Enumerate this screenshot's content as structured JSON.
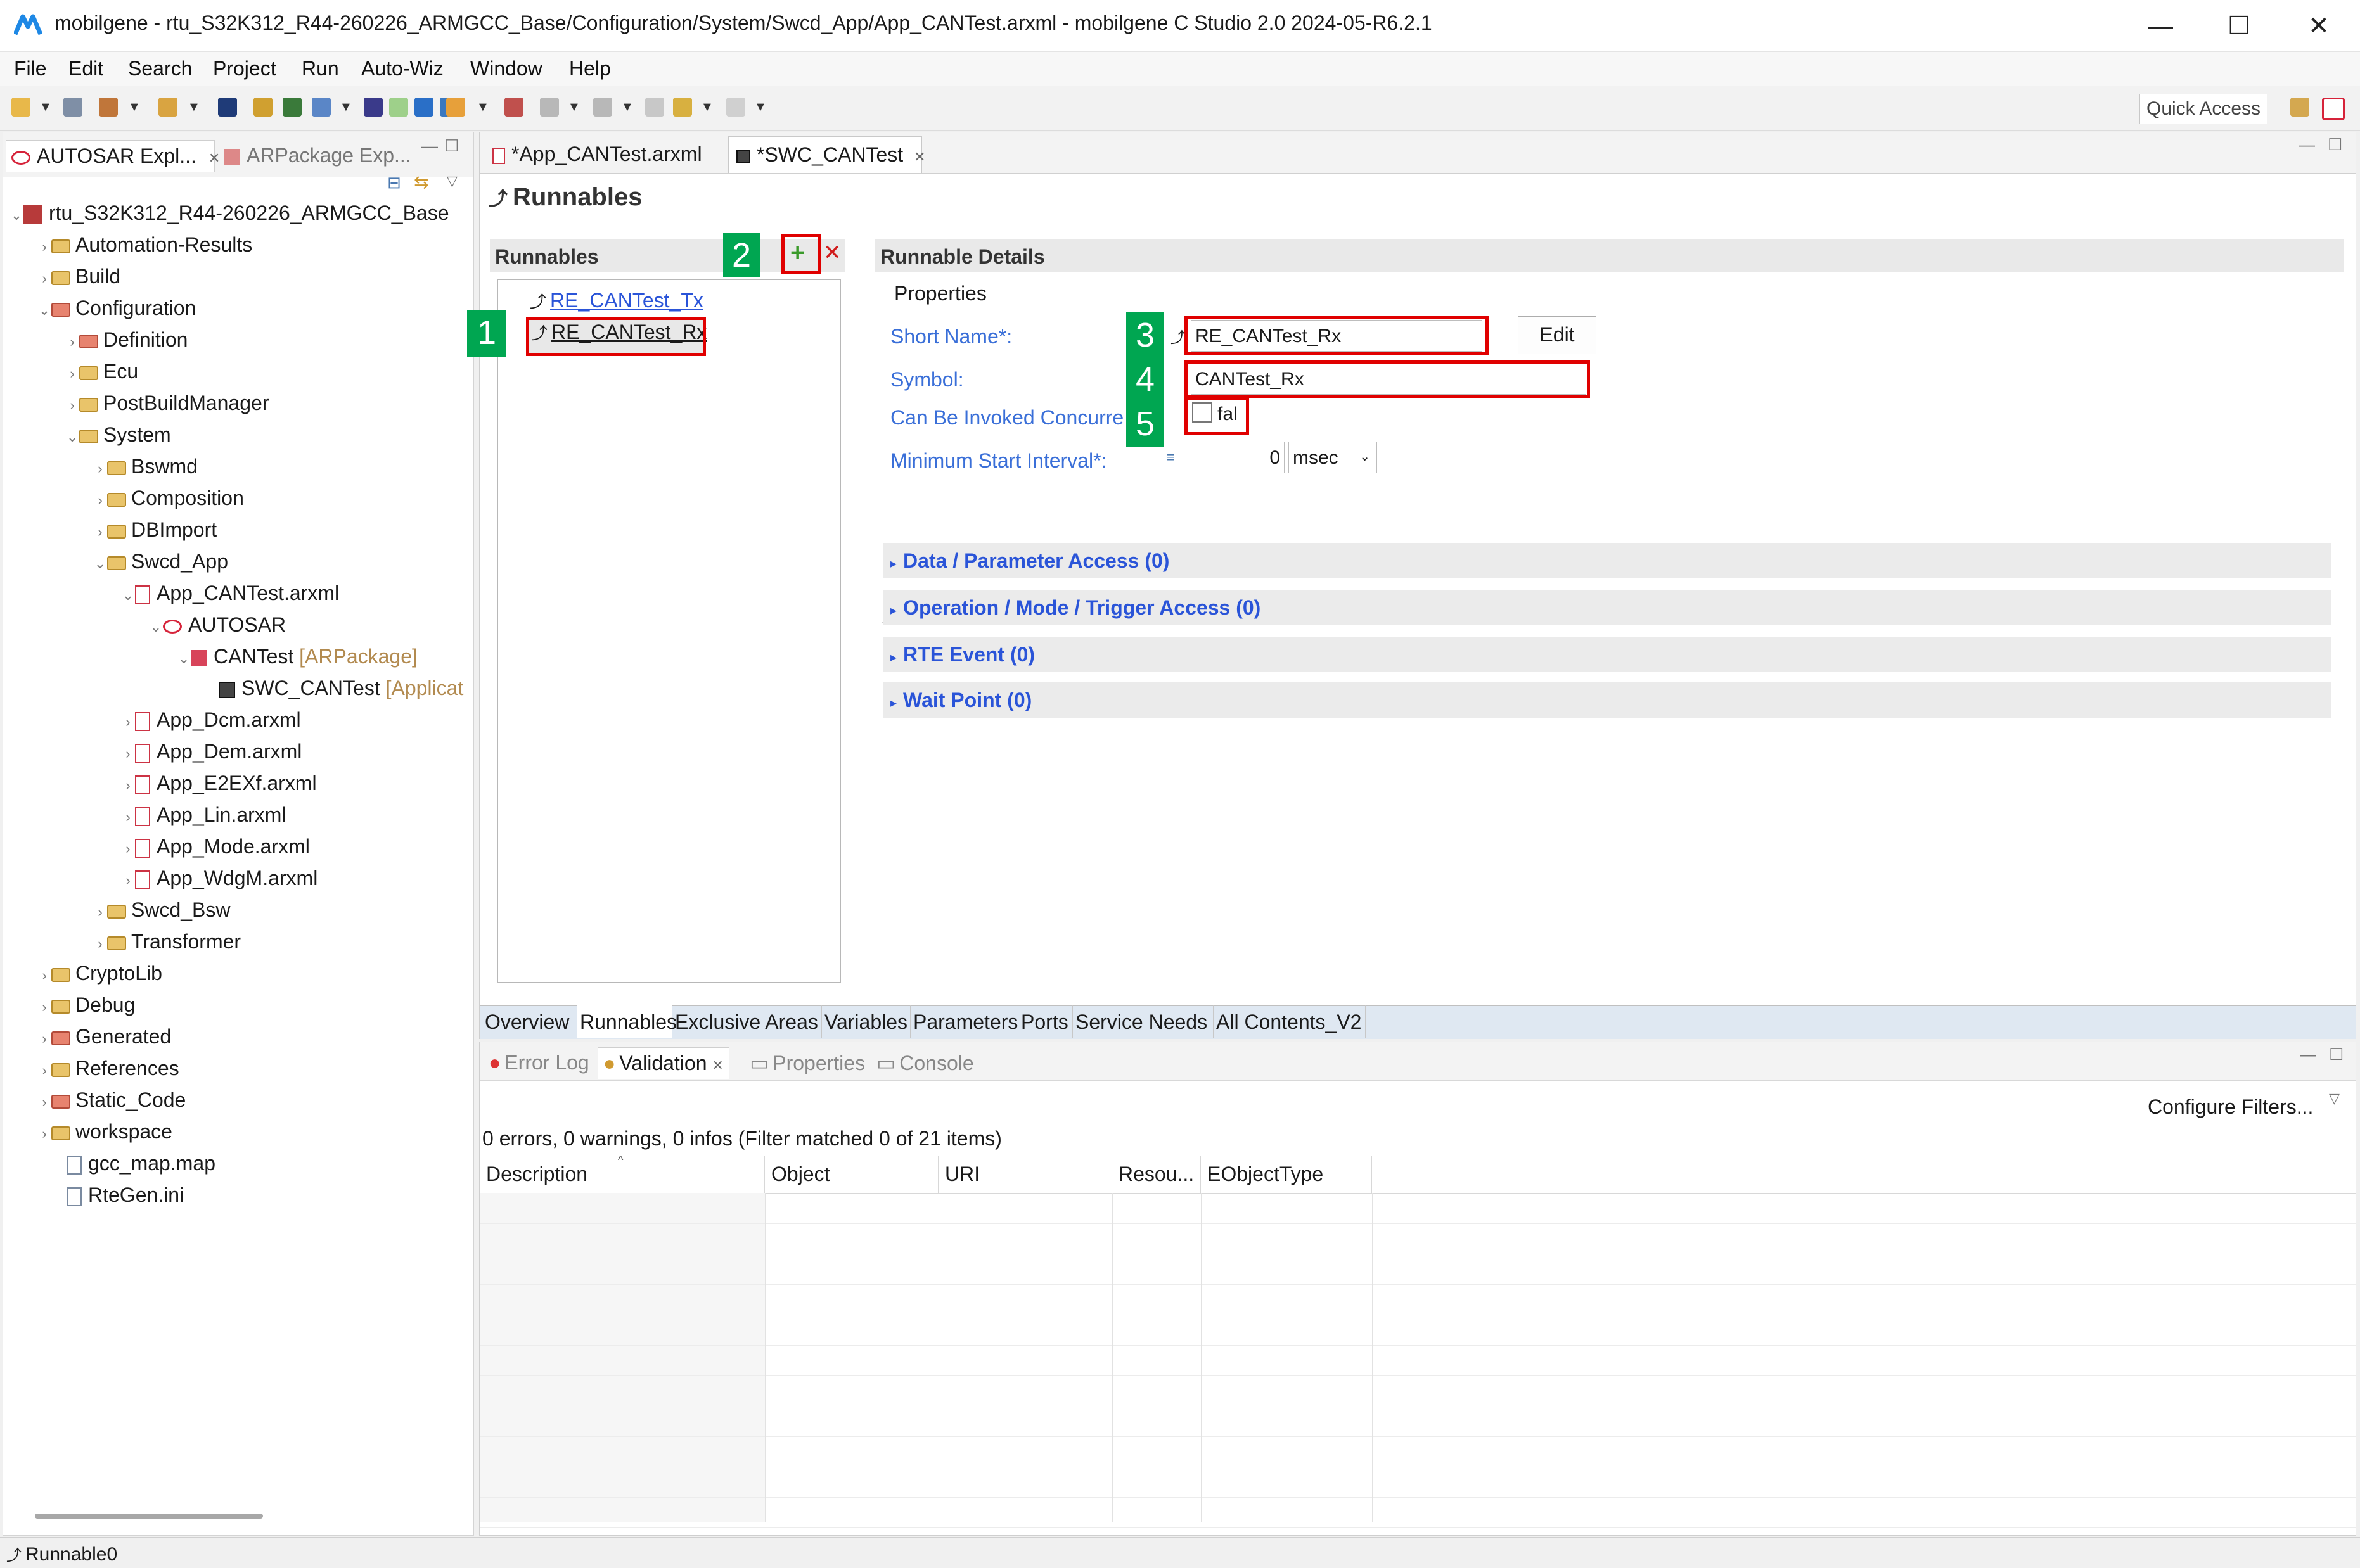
{
  "window": {
    "title": "mobilgene - rtu_S32K312_R44-260226_ARMGCC_Base/Configuration/System/Swcd_App/App_CANTest.arxml - mobilgene C Studio 2.0 2024-05-R6.2.1",
    "minimize": "—",
    "maximize": "☐",
    "close": "✕"
  },
  "menu": [
    "File",
    "Edit",
    "Search",
    "Project",
    "Run",
    "Auto-Wiz",
    "Window",
    "Help"
  ],
  "toolbar": {
    "quick_access": "Quick Access"
  },
  "left_panel": {
    "tabs": [
      "AUTOSAR Expl...",
      "ARPackage Exp..."
    ],
    "tree": [
      {
        "label": "rtu_S32K312_R44-260226_ARMGCC_Base",
        "suffix": ""
      },
      {
        "label": "Automation-Results",
        "suffix": ""
      },
      {
        "label": "Build",
        "suffix": ""
      },
      {
        "label": "Configuration",
        "suffix": ""
      },
      {
        "label": "Definition",
        "suffix": ""
      },
      {
        "label": "Ecu",
        "suffix": ""
      },
      {
        "label": "PostBuildManager",
        "suffix": ""
      },
      {
        "label": "System",
        "suffix": ""
      },
      {
        "label": "Bswmd",
        "suffix": ""
      },
      {
        "label": "Composition",
        "suffix": ""
      },
      {
        "label": "DBImport",
        "suffix": ""
      },
      {
        "label": "Swcd_App",
        "suffix": ""
      },
      {
        "label": "App_CANTest.arxml",
        "suffix": ""
      },
      {
        "label": "AUTOSAR",
        "suffix": ""
      },
      {
        "label": "CANTest",
        "suffix": "[ARPackage]"
      },
      {
        "label": "SWC_CANTest",
        "suffix": "[Applicat"
      },
      {
        "label": "App_Dcm.arxml",
        "suffix": ""
      },
      {
        "label": "App_Dem.arxml",
        "suffix": ""
      },
      {
        "label": "App_E2EXf.arxml",
        "suffix": ""
      },
      {
        "label": "App_Lin.arxml",
        "suffix": ""
      },
      {
        "label": "App_Mode.arxml",
        "suffix": ""
      },
      {
        "label": "App_WdgM.arxml",
        "suffix": ""
      },
      {
        "label": "Swcd_Bsw",
        "suffix": ""
      },
      {
        "label": "Transformer",
        "suffix": ""
      },
      {
        "label": "CryptoLib",
        "suffix": ""
      },
      {
        "label": "Debug",
        "suffix": ""
      },
      {
        "label": "Generated",
        "suffix": ""
      },
      {
        "label": "References",
        "suffix": ""
      },
      {
        "label": "Static_Code",
        "suffix": ""
      },
      {
        "label": "workspace",
        "suffix": ""
      },
      {
        "label": "gcc_map.map",
        "suffix": ""
      },
      {
        "label": "RteGen.ini",
        "suffix": ""
      }
    ]
  },
  "editor": {
    "tabs": [
      "*App_CANTest.arxml",
      "*SWC_CANTest"
    ],
    "page_title": "Runnables",
    "runnables_section": "Runnables",
    "runnables": [
      "RE_CANTest_Tx",
      "RE_CANTest_Rx"
    ],
    "details_section": "Runnable Details",
    "properties_label": "Properties",
    "short_name_label": "Short Name*:",
    "short_name_value": "RE_CANTest_Rx",
    "edit_button": "Edit",
    "symbol_label": "Symbol:",
    "symbol_value": "CANTest_Rx",
    "concurrent_label": "Can Be Invoked Concurre",
    "concurrent_value": "fal",
    "min_interval_label": "Minimum Start Interval*:",
    "min_interval_value": "0",
    "min_interval_unit": "msec",
    "expanders": [
      "Data / Parameter Access (0)",
      "Operation / Mode / Trigger Access (0)",
      "RTE Event (0)",
      "Wait Point (0)"
    ],
    "bottom_tabs": [
      "Overview",
      "Runnables",
      "Exclusive Areas",
      "Variables",
      "Parameters",
      "Ports",
      "Service Needs",
      "All Contents_V2"
    ],
    "badges": [
      "1",
      "2",
      "3",
      "4",
      "5"
    ]
  },
  "bottom_panel": {
    "tabs": [
      "Error Log",
      "Validation",
      "Properties",
      "Console"
    ],
    "configure_filters": "Configure Filters...",
    "summary": "0 errors, 0 warnings, 0 infos (Filter matched 0 of 21 items)",
    "columns": [
      "Description",
      "Object",
      "URI",
      "Resou...",
      "EObjectType"
    ]
  },
  "status": {
    "text": "Runnable0"
  },
  "colors": {
    "highlight_red": "#e00000",
    "badge_green": "#00a651",
    "link_blue": "#2a54d8"
  }
}
